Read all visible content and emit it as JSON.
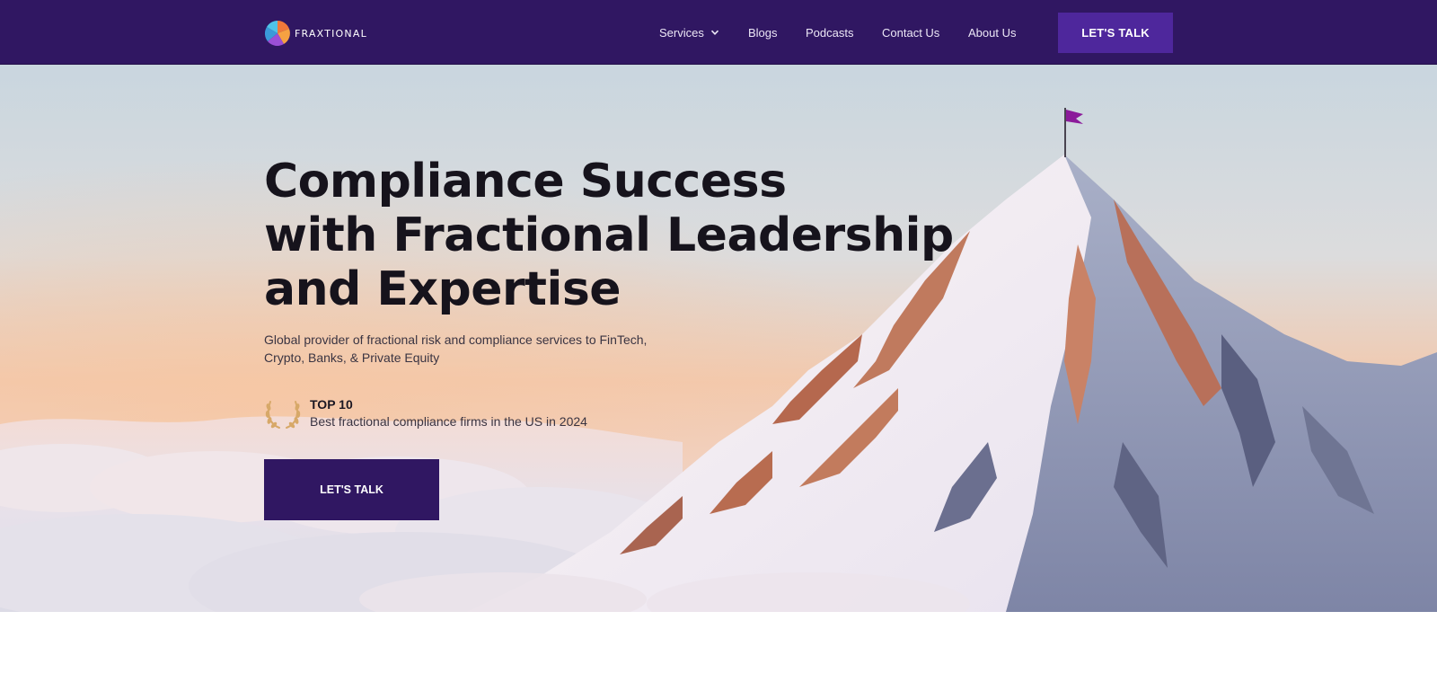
{
  "brand": {
    "name": "FRAXTIONAL"
  },
  "nav": {
    "items": [
      {
        "label": "Services",
        "has_dropdown": true
      },
      {
        "label": "Blogs"
      },
      {
        "label": "Podcasts"
      },
      {
        "label": "Contact Us"
      },
      {
        "label": "About Us"
      }
    ],
    "cta_label": "LET'S TALK"
  },
  "hero": {
    "title_lines": [
      "Compliance Success",
      "with Fractional Leadership",
      "and Expertise"
    ],
    "subtitle": "Global provider of fractional risk and compliance services to FinTech, Crypto, Banks, & Private Equity",
    "award": {
      "title": "TOP 10",
      "description": "Best fractional compliance firms in the US in 2024",
      "icon": "laurel-wreath-icon"
    },
    "cta_label": "LET'S TALK"
  },
  "colors": {
    "header_bg": "#301762",
    "header_cta_bg": "#4e279c",
    "hero_cta_bg": "#301762",
    "flag": "#8b1a9a",
    "laurel": "#d7a868"
  },
  "icons": [
    "chevron-down-icon",
    "fraxtional-logo-icon",
    "laurel-wreath-icon",
    "summit-flag-icon"
  ]
}
